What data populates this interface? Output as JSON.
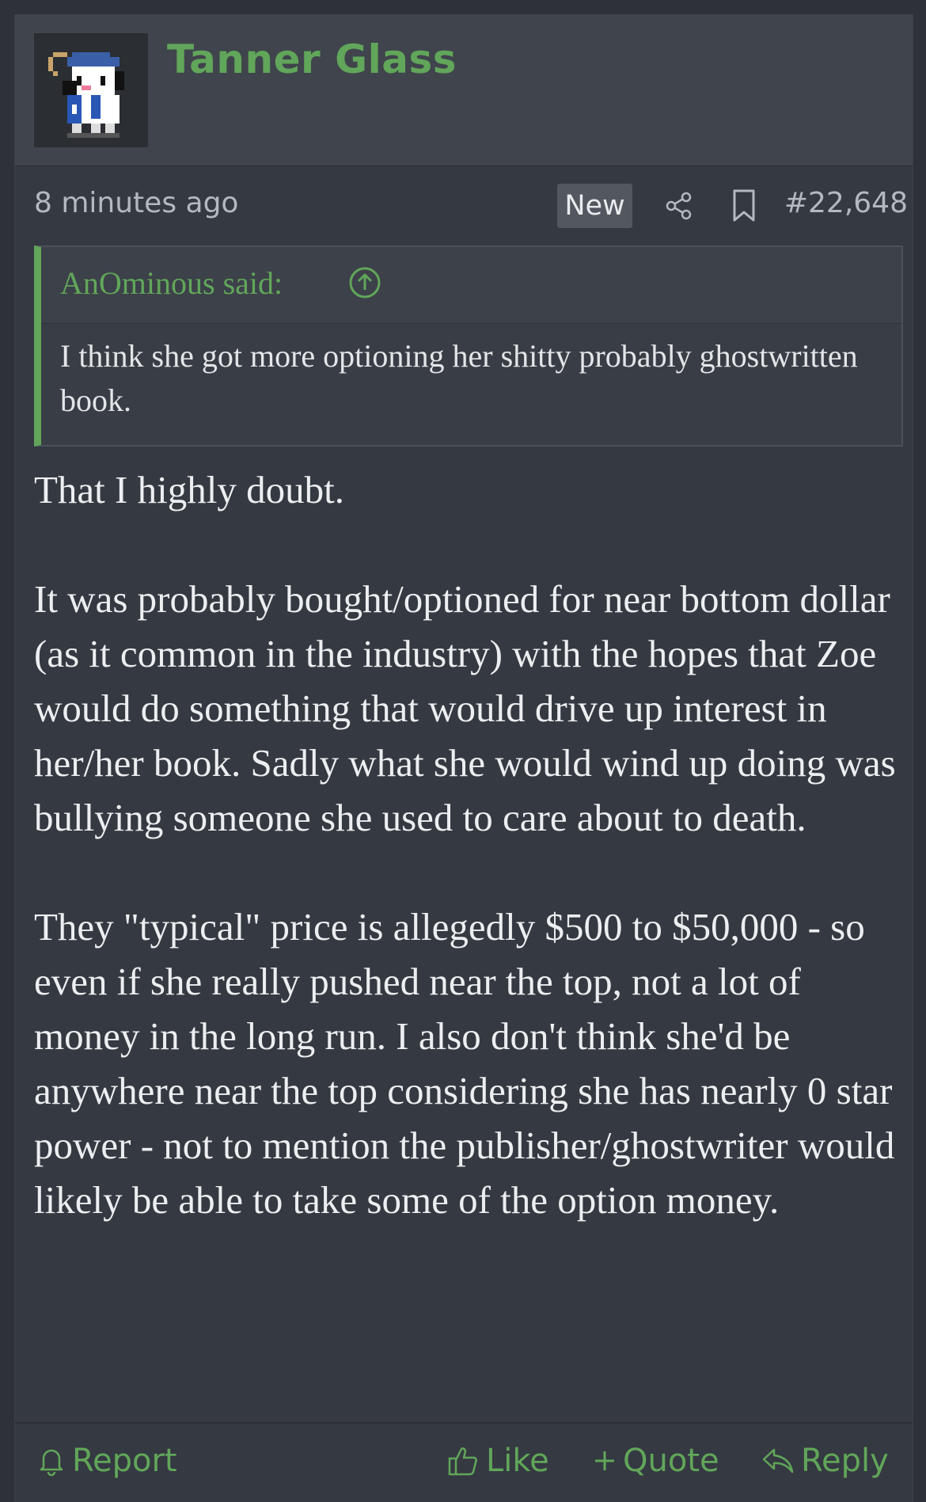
{
  "post": {
    "username": "Tanner Glass",
    "timestamp": "8 minutes ago",
    "badge": "New",
    "post_number": "#22,648",
    "icons": {
      "avatar": "pixel-art-avatar",
      "share": "share-icon",
      "bookmark": "bookmark-icon"
    }
  },
  "quote": {
    "author_label": "AnOminous said:",
    "jump_icon": "arrow-up-circle-icon",
    "text": "I think she got more optioning her shitty probably ghostwritten book."
  },
  "message": {
    "paragraphs": [
      "That I highly doubt.",
      "It was probably bought/optioned for near bottom dollar (as it common in the industry) with the hopes that Zoe would do something that would drive up interest in her/her book. Sadly what she would wind up doing was bullying someone she used to care about to death.",
      "They \"typical\" price is allegedly $500 to $50,000 - so even if she really pushed near the top, not a lot of money in the long run. I also don't think she'd be anywhere near the top considering she has nearly 0 star power - not to mention the publisher/ghostwriter would likely be able to take some of the option money."
    ]
  },
  "footer": {
    "report": "Report",
    "like": "Like",
    "quote": "Quote",
    "reply": "Reply"
  },
  "colors": {
    "accent": "#61a65a",
    "background": "#353941",
    "header": "#40444c",
    "text": "#eceef0"
  }
}
